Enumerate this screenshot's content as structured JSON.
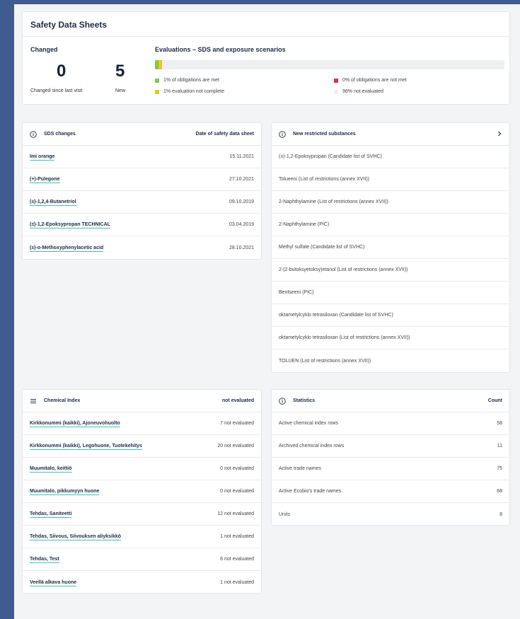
{
  "header": {
    "title": "Safety Data Sheets",
    "changed": {
      "title": "Changed",
      "since_value": "0",
      "since_label": "Changed since last visit",
      "new_value": "5",
      "new_label": "New"
    },
    "evaluations": {
      "title": "Evaluations – SDS and exposure scenarios",
      "met_percent": 1,
      "incomplete_percent": 1,
      "not_met_percent": 0,
      "not_evaluated_percent": 98,
      "legend": {
        "met": "1% of obligations are met",
        "incomplete": "1% evaluation not complete",
        "not_met": "0% of obligations are not met",
        "not_evaluated": "98% not evaluated"
      },
      "colors": {
        "met": "#7cc95a",
        "incomplete": "#f0c419",
        "not_met": "#d0384f",
        "not_evaluated": "#eeeff1"
      }
    }
  },
  "sds_changes": {
    "icon": "info-icon",
    "title": "SDS changes",
    "date_header": "Date of safety data sheet",
    "rows": [
      {
        "name": "Imi orange",
        "date": "15.11.2021"
      },
      {
        "name": "(+)-Pulegone",
        "date": "27.10.2021"
      },
      {
        "name": "(±)-1,2,4-Butanetriol",
        "date": "09.10.2019"
      },
      {
        "name": "(±)-1,2-Epoksypropan TECHNICAL",
        "date": "03.04.2019"
      },
      {
        "name": "(±)-o-Methoxyphenylacetic acid",
        "date": "28.10.2021"
      }
    ]
  },
  "restricted": {
    "icon": "info-icon",
    "title": "New restricted substances",
    "rows": [
      "(±)-1,2-Epoksypropan (Candidate list of SVHC)",
      "Tolueeni (List of restrictions (annex XVII))",
      "2-Naphthylamine (List of restrictions (annex XVII))",
      "2-Naphthylamine (PIC)",
      "Methyl sulfate (Candidate list of SVHC)",
      "2-(2-butoksyetoksy)etanol (List of restrictions (annex XVII))",
      "Bentseeni (PIC)",
      "oktametylcyklo tetrasiloxan (Candidate list of SVHC)",
      "oktametylcyklo tetrasiloxan (List of restrictions (annex XVII))",
      "TOLUEN (List of restrictions (annex XVII))"
    ]
  },
  "chemical_index": {
    "icon": "list-icon",
    "title": "Chemical Index",
    "status_header": "not evaluated",
    "rows": [
      {
        "name": "Kirkkonummi (kaikki), Ajoneuvohuolto",
        "status": "7 not evaluated"
      },
      {
        "name": "Kirkkonummi (kaikki), Legohuone, Tuotekehitys",
        "status": "20 not evaluated"
      },
      {
        "name": "Muumitalo, keittiö",
        "status": "0 not evaluated"
      },
      {
        "name": "Muumitalo, pikkumyyn huone",
        "status": "0 not evaluated"
      },
      {
        "name": "Tehdas, Saniteetti",
        "status": "12 not evaluated"
      },
      {
        "name": "Tehdas, Siivous, Siivouksen aliyksikkö",
        "status": "1 not evaluated"
      },
      {
        "name": "Tehdas, Test",
        "status": "6 not evaluated"
      },
      {
        "name": "Veellä alkava huone",
        "status": "1 not evaluated"
      }
    ]
  },
  "statistics": {
    "icon": "info-icon",
    "title": "Statistics",
    "count_header": "Count",
    "rows": [
      {
        "label": "Active chemical index rows",
        "count": "58"
      },
      {
        "label": "Archived chemical index rows",
        "count": "11"
      },
      {
        "label": "Active trade names",
        "count": "75"
      },
      {
        "label": "Active Ecobio's trade names",
        "count": "68"
      },
      {
        "label": "Units",
        "count": "8"
      }
    ]
  }
}
